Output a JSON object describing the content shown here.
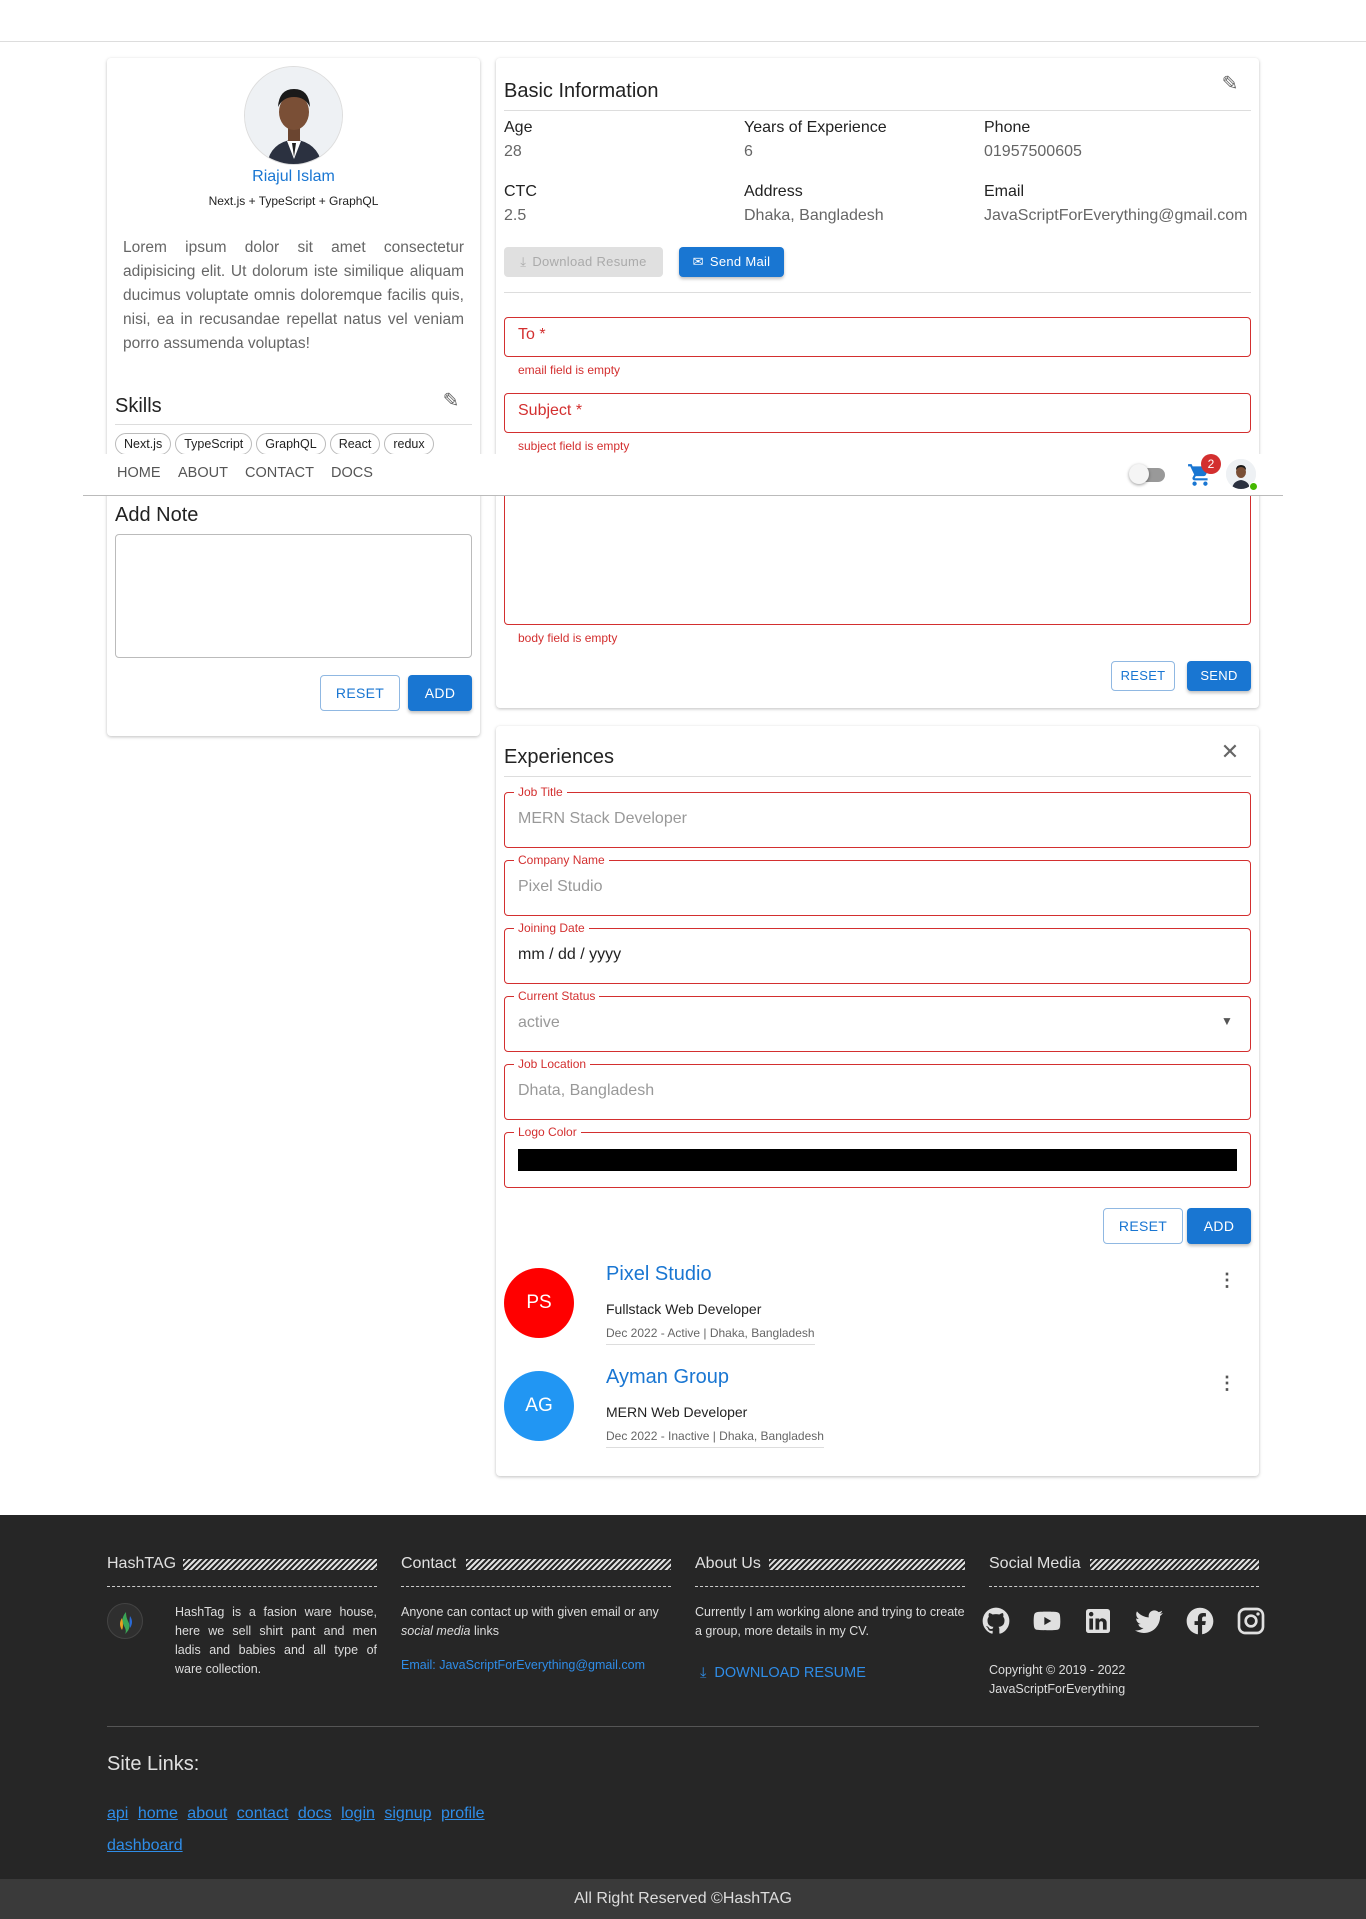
{
  "profile": {
    "name": "Riajul Islam",
    "tagline": "Next.js + TypeScript + GraphQL",
    "bio": "Lorem ipsum dolor sit amet consectetur adipisicing elit. Ut dolorum iste similique aliquam ducimus voluptate omnis doloremque facilis quis, nisi, ea in recusandae repellat natus vel veniam porro assumenda voluptas!"
  },
  "skills": {
    "title": "Skills",
    "items": [
      "Next.js",
      "TypeScript",
      "GraphQL",
      "React",
      "redux"
    ]
  },
  "note": {
    "title": "Add Note",
    "reset_label": "RESET",
    "add_label": "ADD"
  },
  "basic_info": {
    "title": "Basic Information",
    "age_label": "Age",
    "age": "28",
    "experience_label": "Years of Experience",
    "experience": "6",
    "phone_label": "Phone",
    "phone": "01957500605",
    "ctc_label": "CTC",
    "ctc": "2.5",
    "address_label": "Address",
    "address": "Dhaka, Bangladesh",
    "email_label": "Email",
    "email": "JavaScriptForEverything@gmail.com",
    "download_resume_label": "Download Resume",
    "send_mail_label": "Send Mail"
  },
  "mail_form": {
    "to_label": "To *",
    "to_error": "email field is empty",
    "subject_label": "Subject *",
    "subject_error": "subject field is empty",
    "body_error": "body field is empty",
    "reset_label": "RESET",
    "send_label": "SEND"
  },
  "nav": {
    "links": [
      "HOME",
      "ABOUT",
      "CONTACT",
      "DOCS"
    ],
    "cart_count": "2"
  },
  "experiences": {
    "title": "Experiences",
    "job_title_label": "Job Title",
    "job_title_placeholder": "MERN Stack Developer",
    "company_label": "Company Name",
    "company_placeholder": "Pixel Studio",
    "joining_label": "Joining Date",
    "joining_value": "mm / dd / yyyy",
    "status_label": "Current Status",
    "status_value": "active",
    "location_label": "Job Location",
    "location_placeholder": "Dhata, Bangladesh",
    "logo_color_label": "Logo Color",
    "logo_color": "#000000",
    "reset_label": "RESET",
    "add_label": "ADD",
    "items": [
      {
        "initials": "PS",
        "color": "#ff0000",
        "company": "Pixel Studio",
        "role": "Fullstack Web Developer",
        "meta": "Dec 2022 - Active | Dhaka, Bangladesh"
      },
      {
        "initials": "AG",
        "color": "#2196f3",
        "company": "Ayman Group",
        "role": "MERN Web Developer",
        "meta": "Dec 2022 - Inactive | Dhaka, Bangladesh"
      }
    ]
  },
  "footer": {
    "hashtag_title": "HashTAG",
    "hashtag_text": "HashTag is a fasion ware house, here we sell shirt pant and men ladis and babies and all type of ware collection.",
    "contact_title": "Contact",
    "contact_text_1": "Anyone can contact up with given email or any",
    "contact_text_em": "social media",
    "contact_text_2": "links",
    "contact_email": "Email: JavaScriptForEverything@gmail.com",
    "about_title": "About Us",
    "about_text": "Currently I am working alone and trying to create a group, more details in my CV.",
    "download_resume": "DOWNLOAD RESUME",
    "social_title": "Social Media",
    "copyright_1": "Copyright © 2019 - 2022",
    "copyright_2": "JavaScriptForEverything",
    "site_links_title": "Site Links:",
    "site_links": [
      "api",
      "home",
      "about",
      "contact",
      "docs",
      "login",
      "signup",
      "profile",
      "dashboard"
    ],
    "rights": "All Right Reserved ©HashTAG"
  },
  "colors": {
    "primary": "#1976d2",
    "error": "#d32f2f",
    "footer_bg": "#262626"
  }
}
